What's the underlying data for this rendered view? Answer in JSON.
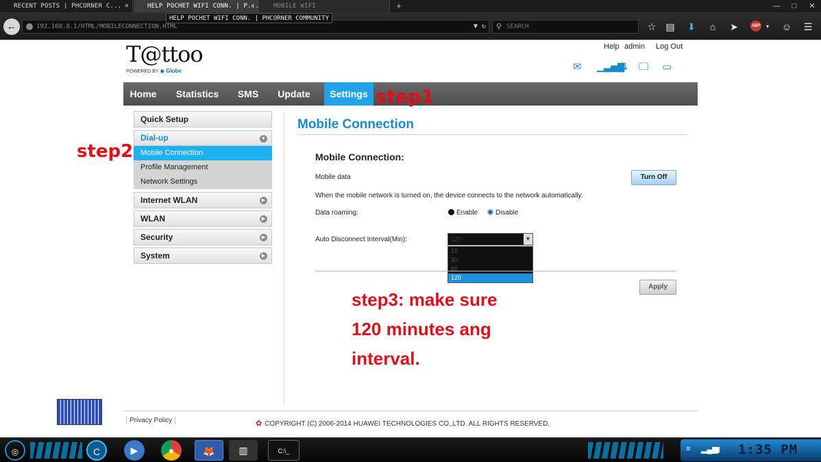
{
  "browser": {
    "tabs": [
      {
        "title": "RECENT POSTS | PHCORNER C...",
        "close": "✕"
      },
      {
        "title": "HELP POCHET WIFI CONN. | P...",
        "close": "✕"
      },
      {
        "title": "MOBILE WIFI",
        "close": ""
      }
    ],
    "tooltip": "HELP POCHET WIFI CONN. | PHCORNER COMMUNITY",
    "url": "192.168.8.1/HTML/MOBILECONNECTION.HTML",
    "search_placeholder": "SEARCH"
  },
  "router": {
    "logo": "T@ttoo",
    "logo_powered": "POWERED BY",
    "logo_brand": "Globe",
    "header_links": {
      "help": "Help",
      "user": "admin",
      "logout": "Log Out"
    },
    "nav": {
      "home": "Home",
      "statistics": "Statistics",
      "sms": "SMS",
      "update": "Update",
      "settings": "Settings"
    },
    "sidebar": {
      "quick_setup": "Quick Setup",
      "dialup": "Dial-up",
      "mobile_connection": "Mobile Connection",
      "profile_management": "Profile Management",
      "network_settings": "Network Settings",
      "internet_wlan": "Internet WLAN",
      "wlan": "WLAN",
      "security": "Security",
      "system": "System"
    },
    "page_title": "Mobile Connection",
    "section_title": "Mobile Connection:",
    "mobile_data_label": "Mobile data",
    "turn_off_button": "Turn Off",
    "info_text": "When the mobile network is turned on, the device connects to the network automatically.",
    "data_roaming_label": "Data roaming:",
    "enable_label": "Enable",
    "disable_label": "Disable",
    "interval_label": "Auto Disconnect Interval(Min):",
    "interval_selected": "120",
    "interval_options": [
      "10",
      "30",
      "60",
      "120"
    ],
    "apply_button": "Apply",
    "privacy_policy": "Privacy Policy",
    "copyright": "COPYRIGHT (C) 2006-2014 HUAWEI TECHNOLOGIES CO.,LTD. ALL RIGHTS RESERVED."
  },
  "annotations": {
    "step1": "step1",
    "step2": "step2",
    "step3_line1": "step3: make sure",
    "step3_line2": "120 minutes ang",
    "step3_line3": "interval."
  },
  "taskbar": {
    "clock": "1:35 PM"
  },
  "colors": {
    "accent_blue": "#1a8ad0",
    "nav_active": "#21a3e6",
    "annotation_red": "#e0101a",
    "sidebar_active": "#1fb1f0"
  }
}
